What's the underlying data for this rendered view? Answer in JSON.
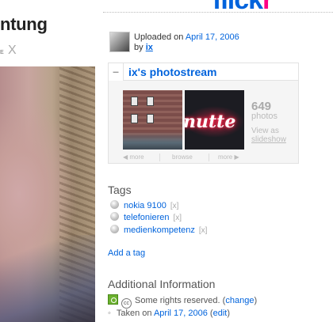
{
  "logo": {
    "text_blue": "flick",
    "text_pink": "r"
  },
  "photo": {
    "title": "ntung",
    "tiny_label": "E",
    "remove_mark": "X"
  },
  "uploader": {
    "uploaded_prefix": "Uploaded on",
    "upload_date": "April 17, 2006",
    "by_prefix": "by",
    "user": "ix"
  },
  "photostream": {
    "collapse_symbol": "–",
    "title": "ix's photostream",
    "count": "649",
    "count_unit": "photos",
    "view_as": "View as",
    "slideshow": "slideshow",
    "nav_prev": "◀ more",
    "nav_browse": "browse",
    "nav_next": "more ▶",
    "thumb2_text": "nutte"
  },
  "tags": {
    "heading": "Tags",
    "items": [
      {
        "label": "nokia 9100",
        "remove": "[x]"
      },
      {
        "label": "telefonieren",
        "remove": "[x]"
      },
      {
        "label": "medienkompetenz",
        "remove": "[x]"
      }
    ],
    "add_label": "Add a tag"
  },
  "info": {
    "heading": "Additional Information",
    "license_icon_text": "cc",
    "license_text": "Some rights reserved.",
    "license_link_open": "(",
    "license_link": "change",
    "license_link_close": ")",
    "taken_prefix": "Taken on",
    "taken_date": "April 17, 2006",
    "edit_link": "edit"
  },
  "colors": {
    "link": "#0063dc",
    "brand_pink": "#ff0084",
    "cc_green": "#6bb12e"
  }
}
